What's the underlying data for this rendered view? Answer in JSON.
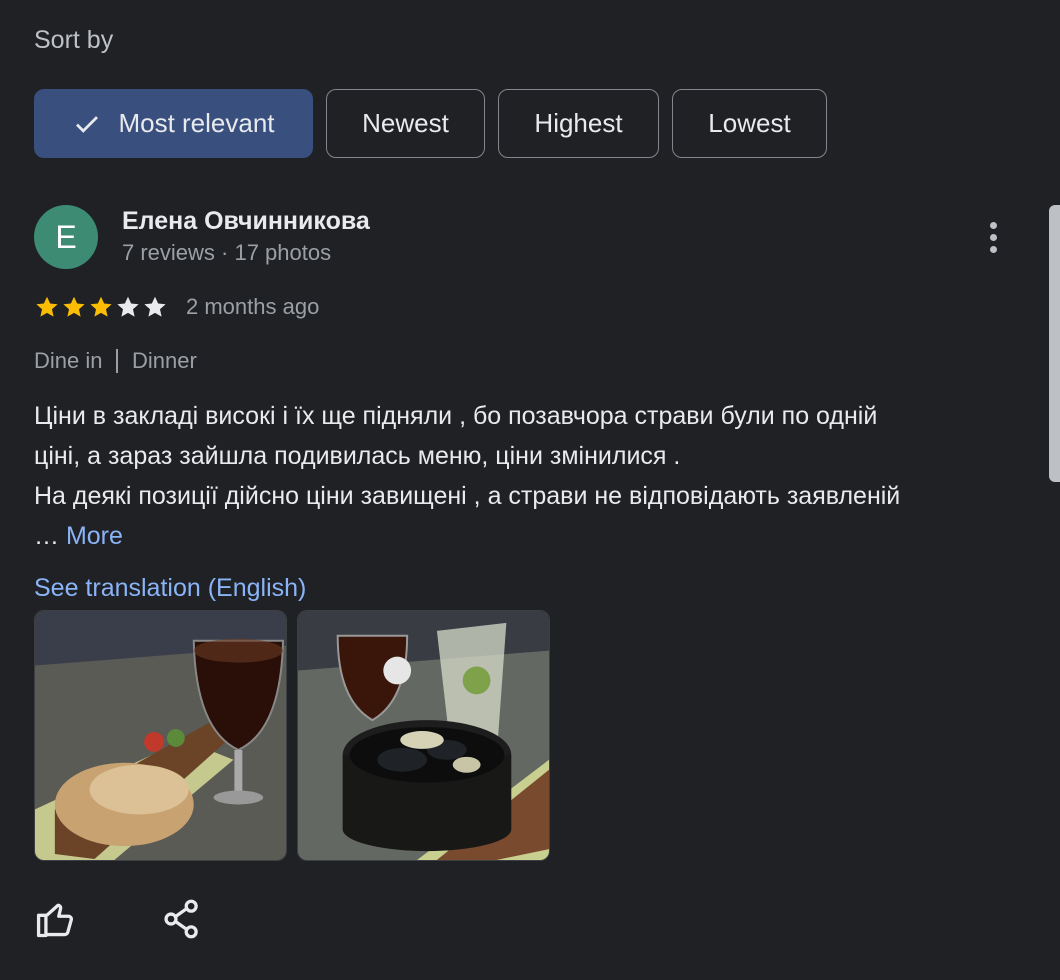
{
  "sort": {
    "title": "Sort by",
    "options": [
      "Most relevant",
      "Newest",
      "Highest",
      "Lowest"
    ],
    "selected": "Most relevant"
  },
  "review": {
    "avatar_letter": "E",
    "avatar_color": "#3d8b72",
    "author": "Елена Овчинникова",
    "author_meta": "7 reviews · 17 photos",
    "rating": 3,
    "max_rating": 5,
    "time": "2 months ago",
    "tags": [
      "Dine in",
      "Dinner"
    ],
    "text_lines": [
      "Ціни в закладі високі і їх ще підняли , бо позавчора страви були по одній",
      "ціні, а зараз зайшла подивилась меню, ціни змінилися .",
      "На деякі позиції дійсно ціни завищені , а страви не відповідають заявленій"
    ],
    "ellipsis": "…",
    "more_label": "More",
    "translate_label": "See translation (English)",
    "photos": [
      "photo-flatbread-beer",
      "photo-mussels-beer"
    ]
  },
  "icons": {
    "selected_check": "check-icon",
    "menu": "more-vert-icon",
    "like": "thumb-up-icon",
    "share": "share-icon"
  },
  "colors": {
    "background": "#202124",
    "selected_chip": "#394f7e",
    "link": "#8ab4f8",
    "star_filled": "#fbbc04",
    "star_empty": "#e8eaed"
  }
}
